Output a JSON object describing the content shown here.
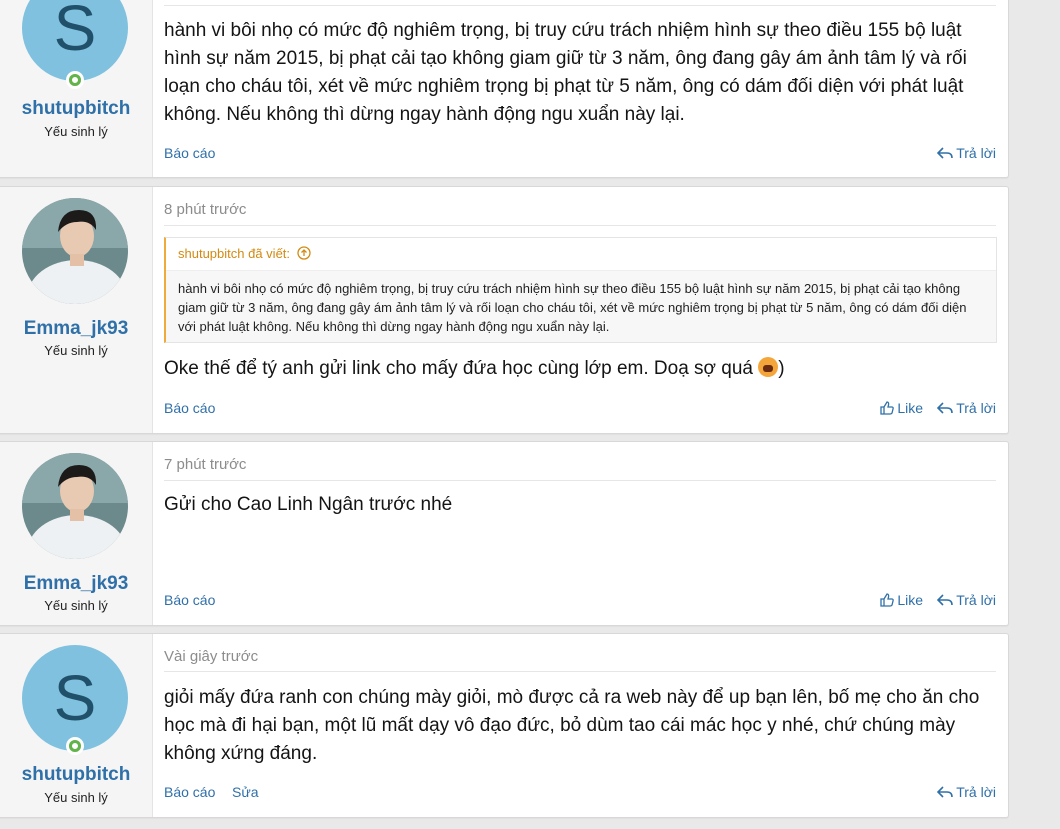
{
  "posts": [
    {
      "username": "shutupbitch",
      "user_title": "Yếu sinh lý",
      "avatar_letter": "S",
      "body": "hành vi bôi nhọ có mức độ nghiêm trọng, bị truy cứu trách nhiệm hình sự theo điều 155 bộ luật hình sự năm 2015, bị phạt cải tạo không giam giữ từ 3 năm, ông đang gây ám ảnh tâm lý và rối loạn cho cháu tôi, xét về mức nghiêm trọng bị phạt từ 5 năm, ông có dám đối diện với phát luật không. Nếu không thì dừng ngay hành động ngu xuẩn này lại.",
      "report": "Báo cáo",
      "reply": "Trả lời"
    },
    {
      "username": "Emma_jk93",
      "user_title": "Yếu sinh lý",
      "time": "8 phút trước",
      "quote_author": "shutupbitch đã viết:",
      "quote_text": "hành vi bôi nhọ có mức độ nghiêm trọng, bị truy cứu trách nhiệm hình sự theo điều 155 bộ luật hình sự năm 2015, bị phạt cải tạo không giam giữ từ 3 năm, ông đang gây ám ảnh tâm lý và rối loạn cho cháu tôi, xét về mức nghiêm trọng bị phạt từ 5 năm, ông có dám đối diện với phát luật không. Nếu không thì dừng ngay hành động ngu xuẩn này lại.",
      "body": "Oke thế để tý anh gửi link cho mấy đứa học cùng lớp em. Doạ sợ quá",
      "body_suffix": ")",
      "report": "Báo cáo",
      "like": "Like",
      "reply": "Trả lời"
    },
    {
      "username": "Emma_jk93",
      "user_title": "Yếu sinh lý",
      "time": "7 phút trước",
      "body": "Gửi cho Cao Linh Ngân trước nhé",
      "report": "Báo cáo",
      "like": "Like",
      "reply": "Trả lời"
    },
    {
      "username": "shutupbitch",
      "user_title": "Yếu sinh lý",
      "avatar_letter": "S",
      "time": "Vài giây trước",
      "body": "giỏi mấy đứa ranh con chúng mày giỏi, mò được cả ra web này để up bạn lên, bố mẹ cho ăn cho học mà đi hại bạn, một lũ mất dạy vô đạo đức, bỏ dùm tao cái mác học y nhé, chứ chúng mày không xứng đáng.",
      "report": "Báo cáo",
      "edit": "Sửa",
      "reply": "Trả lời"
    }
  ],
  "colors": {
    "link": "#2f70a8",
    "avatar_bg": "#7fc1de",
    "online": "#63b34b",
    "quote_accent": "#f0a93b"
  }
}
